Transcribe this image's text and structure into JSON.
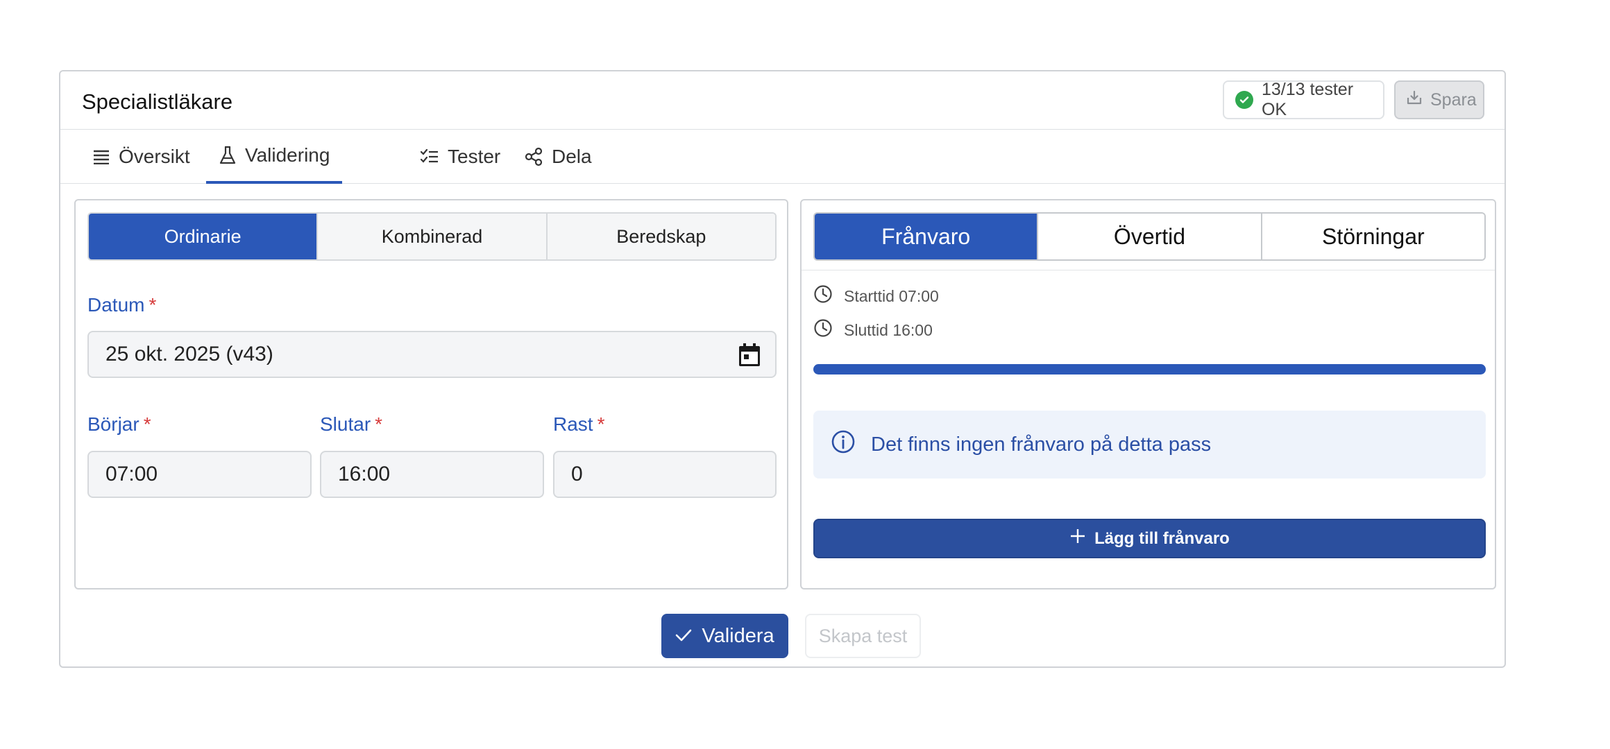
{
  "header": {
    "title": "Specialistläkare",
    "status_badge": "13/13 tester OK",
    "save_label": "Spara"
  },
  "tabs": [
    {
      "label": "Översikt",
      "icon": "list-icon"
    },
    {
      "label": "Validering",
      "icon": "flask-icon",
      "active": true
    },
    {
      "label": "Tester",
      "icon": "checklist-icon"
    },
    {
      "label": "Dela",
      "icon": "share-icon"
    }
  ],
  "left_panel": {
    "segments": [
      "Ordinarie",
      "Kombinerad",
      "Beredskap"
    ],
    "active_segment": "Ordinarie",
    "date": {
      "label": "Datum",
      "required_mark": "*",
      "value": "25 okt. 2025 (v43)"
    },
    "start": {
      "label": "Börjar",
      "required_mark": "*",
      "value": "07:00"
    },
    "end": {
      "label": "Slutar",
      "required_mark": "*",
      "value": "16:00"
    },
    "break": {
      "label": "Rast",
      "required_mark": "*",
      "value": "0"
    }
  },
  "right_panel": {
    "segments": [
      "Frånvaro",
      "Övertid",
      "Störningar"
    ],
    "active_segment": "Frånvaro",
    "start_time": "Starttid 07:00",
    "end_time": "Sluttid 16:00",
    "progress": 1.0,
    "info_message": "Det finns ingen frånvaro på detta pass",
    "add_button_label": "Lägg till frånvaro"
  },
  "footer": {
    "validate_label": "Validera",
    "create_test_label": "Skapa test"
  },
  "colors": {
    "accent": "#2b58b8",
    "success": "#2fa84f",
    "required": "#d63b3b"
  }
}
